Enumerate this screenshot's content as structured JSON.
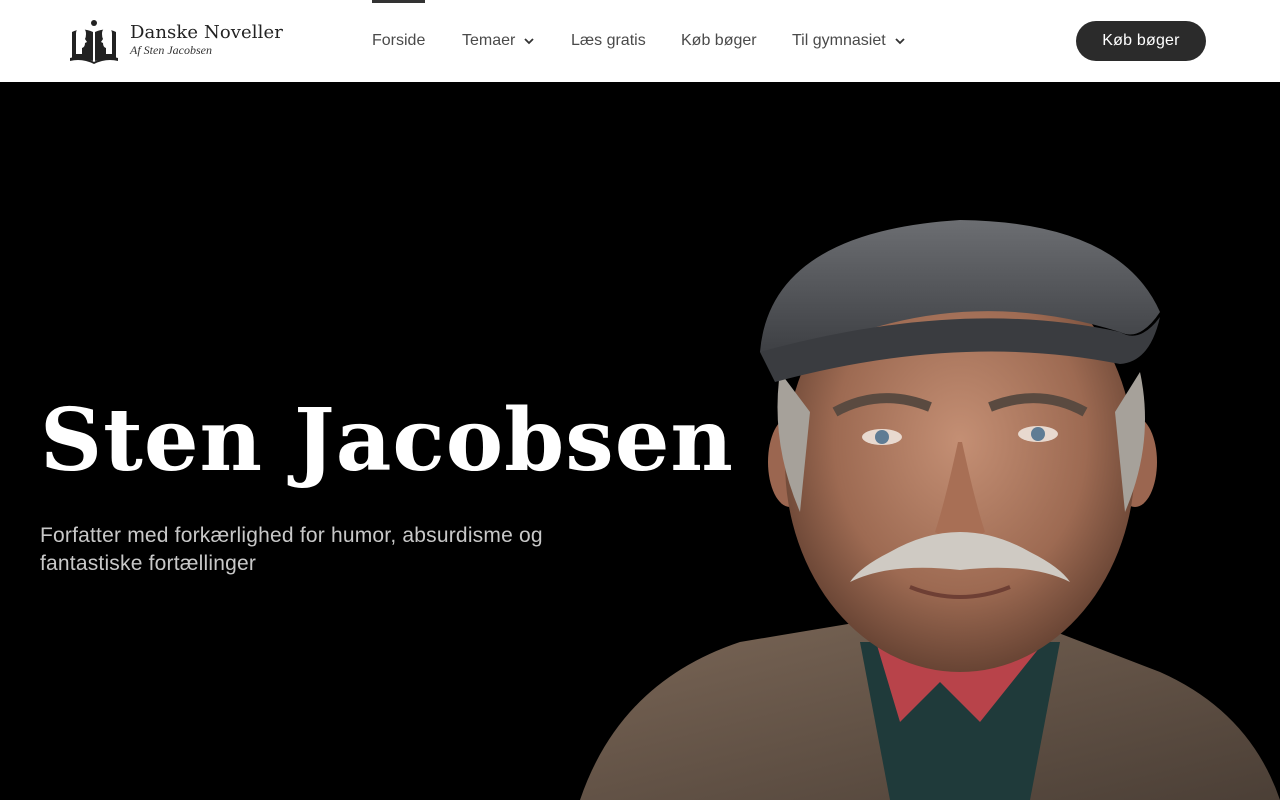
{
  "brand": {
    "title": "Danske Noveller",
    "subtitle": "Af Sten Jacobsen",
    "logo_icon": "book-silhouettes-icon"
  },
  "nav": {
    "items": [
      {
        "label": "Forside",
        "active": true,
        "has_dropdown": false
      },
      {
        "label": "Temaer",
        "active": false,
        "has_dropdown": true
      },
      {
        "label": "Læs gratis",
        "active": false,
        "has_dropdown": false
      },
      {
        "label": "Køb bøger",
        "active": false,
        "has_dropdown": false
      },
      {
        "label": "Til gymnasiet",
        "active": false,
        "has_dropdown": true
      }
    ]
  },
  "header_cta": {
    "label": "Køb bøger",
    "color": "#2b2b2b"
  },
  "hero": {
    "title": "Sten Jacobsen",
    "subtitle": "Forfatter med forkærlighed for humor, absurdisme og fantastiske fortællinger",
    "background": "#000000",
    "image_icon": "author-portrait"
  }
}
